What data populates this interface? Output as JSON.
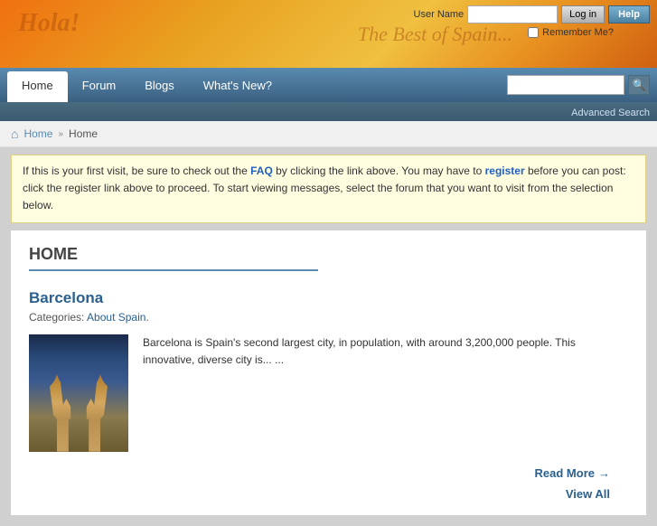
{
  "header": {
    "logo_text": "Hola!",
    "tagline": "The Best of Spain...",
    "login": {
      "username_label": "User Name",
      "login_button": "Log in",
      "help_button": "Help",
      "remember_label": "Remember Me?"
    }
  },
  "navbar": {
    "items": [
      {
        "label": "Home",
        "active": true
      },
      {
        "label": "Forum",
        "active": false
      },
      {
        "label": "Blogs",
        "active": false
      },
      {
        "label": "What's New?",
        "active": false
      }
    ],
    "search_placeholder": "",
    "advanced_search": "Advanced Search"
  },
  "breadcrumb": {
    "home_label": "Home",
    "current": "Home"
  },
  "info_box": {
    "text_before_faq": "If this is your first visit, be sure to check out the ",
    "faq_label": "FAQ",
    "text_after_faq": " by clicking the link above. You may have to ",
    "register_label": "register",
    "text_after_register": " before you can post: click the register link above to proceed. To start viewing messages, select the forum that you want to visit from the selection below."
  },
  "main": {
    "title": "HOME",
    "article": {
      "title": "Barcelona",
      "categories_label": "Categories:",
      "category": "About Spain",
      "text": "Barcelona is Spain's second largest city, in population, with around 3,200,000 people. This innovative, diverse city is... ...",
      "read_more": "Read More",
      "view_all": "View All"
    }
  }
}
